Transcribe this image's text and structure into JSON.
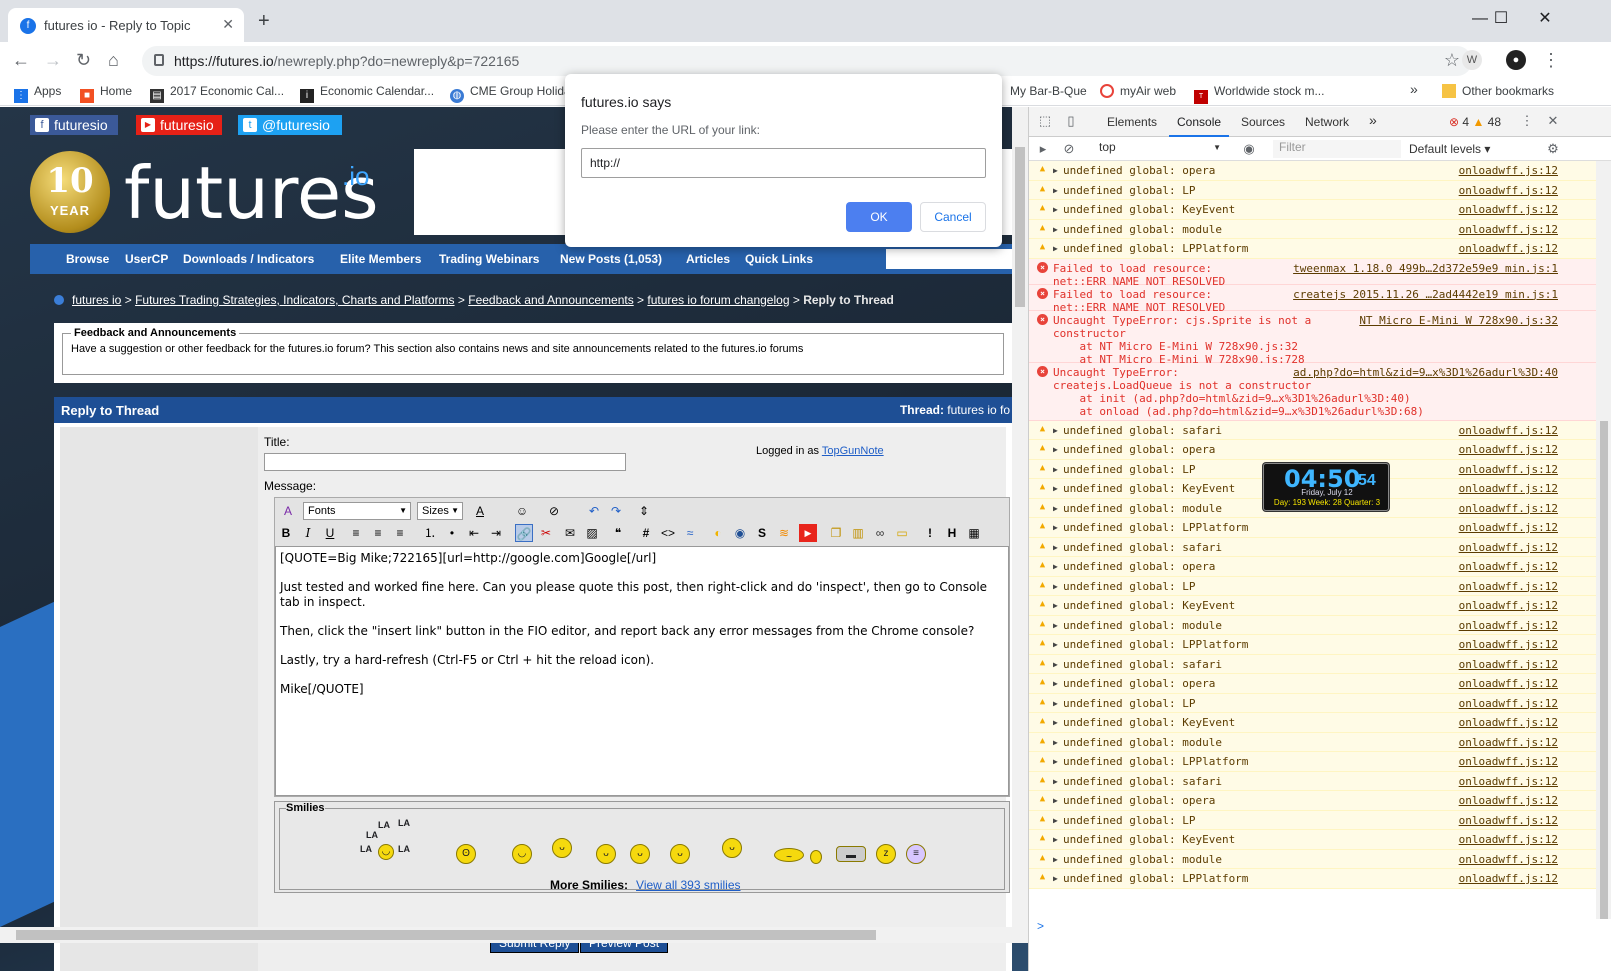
{
  "browser": {
    "tab_title": "futures io - Reply to Topic",
    "new_tab": "+",
    "url_host": "https://futures.io",
    "url_path": "/newreply.php?do=newreply&p=722165",
    "window_controls": {
      "minimize": "—",
      "maximize": "☐",
      "close": "✕"
    }
  },
  "bookmarks": [
    {
      "label": "Apps",
      "icon": "apps-grid-icon",
      "color": "#1a73e8"
    },
    {
      "label": "Home",
      "icon": "windows-icon",
      "color": "#f25022"
    },
    {
      "label": "2017 Economic Cal...",
      "icon": "calendar-icon",
      "color": "#333333"
    },
    {
      "label": "Economic Calendar...",
      "icon": "inv-icon",
      "color": "#222222"
    },
    {
      "label": "CME Group Holida",
      "icon": "globe-icon",
      "color": "#3a7bd5"
    },
    {
      "label": "My Bar-B-Que",
      "icon": "",
      "color": ""
    },
    {
      "label": "myAir web",
      "icon": "myair-icon",
      "color": "#e8433a"
    },
    {
      "label": "Worldwide stock m...",
      "icon": "time-icon",
      "color": "#c00000"
    },
    {
      "label": "»",
      "icon": "",
      "color": ""
    },
    {
      "label": "Other bookmarks",
      "icon": "folder-icon",
      "color": "#f6c344"
    }
  ],
  "social": [
    {
      "label": "futuresio",
      "icon": "f",
      "color": "#3b5998"
    },
    {
      "label": "futuresio",
      "icon": "▶",
      "color": "#e62117"
    },
    {
      "label": "@futuresio",
      "icon": "t",
      "color": "#1da1f2"
    }
  ],
  "logo": {
    "badge_number": "10",
    "badge_text": "YEAR",
    "word": "futures",
    "suffix": ".io"
  },
  "navbar": [
    "Browse",
    "UserCP",
    "Downloads / Indicators",
    "Elite Members",
    "Trading Webinars",
    "New Posts (1,053)",
    "Articles",
    "Quick Links"
  ],
  "breadcrumbs": [
    "futures io",
    "Futures Trading Strategies, Indicators, Charts and Platforms",
    "Feedback and Announcements",
    "futures io forum changelog"
  ],
  "breadcrumb_sep": ">",
  "breadcrumb_current": "Reply to Thread",
  "forum_box": {
    "legend": "Feedback and Announcements",
    "description": "Have a suggestion or other feedback for the futures.io forum? This section also contains news and site announcements related to the futures.io forums"
  },
  "reply": {
    "header": "Reply to Thread",
    "thread_label": "Thread:",
    "thread_name": "futures io fo",
    "title_label": "Title:",
    "logged_in_label": "Logged in as",
    "user": "TopGunNote",
    "message_label": "Message:",
    "fonts_select": "Fonts",
    "sizes_select": "Sizes",
    "message_lines": [
      "[QUOTE=Big Mike;722165][url=http://google.com]Google[/url]",
      "Just tested and worked fine here.  Can you please quote this post, then right-click and do 'inspect', then go to Console tab in inspect.",
      "Then, click the \"insert link\" button in the FIO editor, and report back any error messages from the Chrome console?",
      "Lastly, try a hard-refresh (Ctrl-F5 or Ctrl + hit the reload icon).",
      "Mike[/QUOTE]"
    ],
    "smilies_legend": "Smilies",
    "smilie_lala": "LA",
    "more_smilies_label": "More Smilies:",
    "view_all": "View all 393 smilies",
    "submit": "Submit Reply",
    "preview": "Preview Post"
  },
  "alert": {
    "title": "futures.io says",
    "message": "Please enter the URL of your link:",
    "value": "http://",
    "ok": "OK",
    "cancel": "Cancel"
  },
  "devtools": {
    "tabs": [
      "Elements",
      "Console",
      "Sources",
      "Network",
      "»"
    ],
    "active_tab": "Console",
    "error_count": "4",
    "warning_count": "48",
    "context": "top",
    "filter_placeholder": "Filter",
    "levels": "Default levels ▾",
    "prompt": ">",
    "log": [
      {
        "type": "warn",
        "msg": "undefined global: opera",
        "src": "onloadwff.js:12"
      },
      {
        "type": "warn",
        "msg": "undefined global: LP",
        "src": "onloadwff.js:12"
      },
      {
        "type": "warn",
        "msg": "undefined global: KeyEvent",
        "src": "onloadwff.js:12"
      },
      {
        "type": "warn",
        "msg": "undefined global: module",
        "src": "onloadwff.js:12"
      },
      {
        "type": "warn",
        "msg": "undefined global: LPPlatform",
        "src": "onloadwff.js:12"
      },
      {
        "type": "err",
        "msg": "Failed to load resource:\nnet::ERR_NAME_NOT_RESOLVED",
        "src": "tweenmax 1.18.0 499b…2d372e59e9 min.js:1"
      },
      {
        "type": "err",
        "msg": "Failed to load resource:\nnet::ERR_NAME_NOT_RESOLVED",
        "src": "createjs 2015.11.26 …2ad4442e19 min.js:1"
      },
      {
        "type": "err",
        "msg": "Uncaught TypeError: cjs.Sprite is not a\nconstructor\n    at NT Micro E-Mini W 728x90.js:32\n    at NT Micro E-Mini W 728x90.js:728",
        "src": "NT Micro E-Mini W 728x90.js:32"
      },
      {
        "type": "err",
        "msg": "Uncaught TypeError:\ncreatejs.LoadQueue is not a constructor\n    at init (ad.php?do=html&zid=9…x%3D1%26adurl%3D:40)\n    at onload (ad.php?do=html&zid=9…x%3D1%26adurl%3D:68)",
        "src": "ad.php?do=html&zid=9…x%3D1%26adurl%3D:40"
      },
      {
        "type": "warn",
        "msg": "undefined global: safari",
        "src": "onloadwff.js:12"
      },
      {
        "type": "warn",
        "msg": "undefined global: opera",
        "src": "onloadwff.js:12"
      },
      {
        "type": "warn",
        "msg": "undefined global: LP",
        "src": "onloadwff.js:12"
      },
      {
        "type": "warn",
        "msg": "undefined global: KeyEvent",
        "src": "onloadwff.js:12"
      },
      {
        "type": "warn",
        "msg": "undefined global: module",
        "src": "onloadwff.js:12"
      },
      {
        "type": "warn",
        "msg": "undefined global: LPPlatform",
        "src": "onloadwff.js:12"
      },
      {
        "type": "warn",
        "msg": "undefined global: safari",
        "src": "onloadwff.js:12"
      },
      {
        "type": "warn",
        "msg": "undefined global: opera",
        "src": "onloadwff.js:12"
      },
      {
        "type": "warn",
        "msg": "undefined global: LP",
        "src": "onloadwff.js:12"
      },
      {
        "type": "warn",
        "msg": "undefined global: KeyEvent",
        "src": "onloadwff.js:12"
      },
      {
        "type": "warn",
        "msg": "undefined global: module",
        "src": "onloadwff.js:12"
      },
      {
        "type": "warn",
        "msg": "undefined global: LPPlatform",
        "src": "onloadwff.js:12"
      },
      {
        "type": "warn",
        "msg": "undefined global: safari",
        "src": "onloadwff.js:12"
      },
      {
        "type": "warn",
        "msg": "undefined global: opera",
        "src": "onloadwff.js:12"
      },
      {
        "type": "warn",
        "msg": "undefined global: LP",
        "src": "onloadwff.js:12"
      },
      {
        "type": "warn",
        "msg": "undefined global: KeyEvent",
        "src": "onloadwff.js:12"
      },
      {
        "type": "warn",
        "msg": "undefined global: module",
        "src": "onloadwff.js:12"
      },
      {
        "type": "warn",
        "msg": "undefined global: LPPlatform",
        "src": "onloadwff.js:12"
      },
      {
        "type": "warn",
        "msg": "undefined global: safari",
        "src": "onloadwff.js:12"
      },
      {
        "type": "warn",
        "msg": "undefined global: opera",
        "src": "onloadwff.js:12"
      },
      {
        "type": "warn",
        "msg": "undefined global: LP",
        "src": "onloadwff.js:12"
      },
      {
        "type": "warn",
        "msg": "undefined global: KeyEvent",
        "src": "onloadwff.js:12"
      },
      {
        "type": "warn",
        "msg": "undefined global: module",
        "src": "onloadwff.js:12"
      },
      {
        "type": "warn",
        "msg": "undefined global: LPPlatform",
        "src": "onloadwff.js:12"
      }
    ]
  },
  "clock": {
    "time": "04:50",
    "seconds": "54",
    "date": "Friday, July 12",
    "info": "Day: 193  Week: 28  Quarter: 3"
  }
}
